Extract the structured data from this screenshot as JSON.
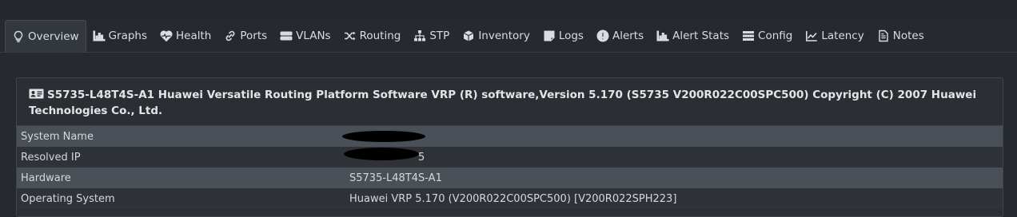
{
  "tabs": [
    {
      "label": "Overview",
      "icon": "lightbulb-icon",
      "active": true
    },
    {
      "label": "Graphs",
      "icon": "bar-chart-icon"
    },
    {
      "label": "Health",
      "icon": "heartbeat-icon"
    },
    {
      "label": "Ports",
      "icon": "link-icon"
    },
    {
      "label": "VLANs",
      "icon": "server-icon"
    },
    {
      "label": "Routing",
      "icon": "shuffle-icon"
    },
    {
      "label": "STP",
      "icon": "sitemap-icon"
    },
    {
      "label": "Inventory",
      "icon": "cube-icon"
    },
    {
      "label": "Logs",
      "icon": "sticky-note-icon"
    },
    {
      "label": "Alerts",
      "icon": "exclamation-circle-icon"
    },
    {
      "label": "Alert Stats",
      "icon": "bar-chart-icon"
    },
    {
      "label": "Config",
      "icon": "list-icon"
    },
    {
      "label": "Latency",
      "icon": "line-chart-icon"
    },
    {
      "label": "Notes",
      "icon": "file-text-icon"
    }
  ],
  "panel": {
    "title": "S5735-L48T4S-A1 Huawei Versatile Routing Platform Software VRP (R) software,Version 5.170 (S5735 V200R022C00SPC500) Copyright (C) 2007 Huawei Technologies Co., Ltd.",
    "icon": "id-card-icon",
    "rows": [
      {
        "key": "System Name",
        "value": ""
      },
      {
        "key": "Resolved IP",
        "value": "5"
      },
      {
        "key": "Hardware",
        "value": "S5735-L48T4S-A1"
      },
      {
        "key": "Operating System",
        "value": "Huawei VRP 5.170 (V200R022C00SPC500) [V200R022SPH223]"
      }
    ]
  },
  "colors": {
    "background": "#262a2e",
    "panel": "#2b2f34",
    "row_alt": "#4a5057",
    "text": "#d4d8dc"
  }
}
